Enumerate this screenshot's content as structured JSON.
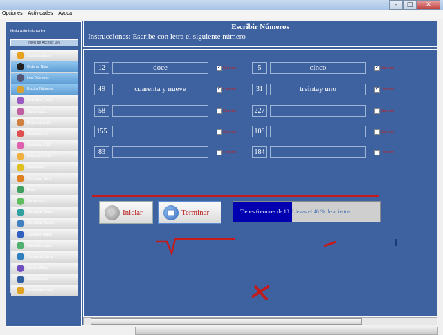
{
  "window": {
    "min": "–",
    "max": "□",
    "close": "✕"
  },
  "menu": [
    "Opciones",
    "Actividades",
    "Ayuda"
  ],
  "sidebar": {
    "greeting": "Hola Administrador",
    "level": "Nivel de Acceso: 0%",
    "items": [
      {
        "label": "Cuenta Líquido",
        "color": "#e8a020"
      },
      {
        "label": "Ordenar Núm.",
        "color": "#222222"
      },
      {
        "label": "Leer Números",
        "color": "#555577"
      },
      {
        "label": "Escribir Números",
        "color": "#d9a030"
      },
      {
        "label": "Ordinales 1 a 10",
        "color": "#9a5ac0"
      },
      {
        "label": "Suma hasta...",
        "color": "#c060a0"
      },
      {
        "label": "Resta hasta 10",
        "color": "#d08040"
      },
      {
        "label": "Multiplicar 1-5",
        "color": "#e05050"
      },
      {
        "label": "Multiplicar 1-10",
        "color": "#e060b0"
      },
      {
        "label": "Divisiones 1-10",
        "color": "#f0b040"
      },
      {
        "label": "Fracciones",
        "color": "#e0c020"
      },
      {
        "label": "Comparar Núm.",
        "color": "#e08020"
      },
      {
        "label": "Reloj",
        "color": "#40a060"
      },
      {
        "label": "Series num.",
        "color": "#60c060"
      },
      {
        "label": "Completar Series",
        "color": "#30a0a0"
      },
      {
        "label": "Completar Figura",
        "color": "#4080c0"
      },
      {
        "label": "Calcula el doble",
        "color": "#3060c0"
      },
      {
        "label": "Calcula la mitad",
        "color": "#50b070"
      },
      {
        "label": "Completar Suma",
        "color": "#3080c0"
      },
      {
        "label": "Suma y Resta",
        "color": "#7050c0"
      },
      {
        "label": "Multiplicación",
        "color": "#3060a0"
      },
      {
        "label": "Problemas Suma",
        "color": "#e0a020"
      }
    ]
  },
  "header": {
    "title": "Escribir Números",
    "instructions": "Instrucciones: Escribe con letra el siguiente número"
  },
  "rows": [
    {
      "left": {
        "num": "12",
        "ans": "doce",
        "checked": true
      },
      "right": {
        "num": "5",
        "ans": "cinco",
        "checked": true
      }
    },
    {
      "left": {
        "num": "49",
        "ans": "cuarenta y nueve",
        "checked": true
      },
      "right": {
        "num": "31",
        "ans": "treintay uno",
        "checked": true
      }
    },
    {
      "left": {
        "num": "58",
        "ans": "",
        "checked": false
      },
      "right": {
        "num": "227",
        "ans": "",
        "checked": false
      }
    },
    {
      "left": {
        "num": "155",
        "ans": "",
        "checked": false
      },
      "right": {
        "num": "108",
        "ans": "",
        "checked": false
      }
    },
    {
      "left": {
        "num": "83",
        "ans": "",
        "checked": false
      },
      "right": {
        "num": "184",
        "ans": "",
        "checked": false
      }
    }
  ],
  "check_label": "Correcto",
  "buttons": {
    "start": "Iniciar",
    "finish": "Terminar"
  },
  "status": {
    "errors_text": "Tienes 6 errores de 10.",
    "hits_text": "Llevas el 40 % de aciertos",
    "fill_fraction": 0.4
  },
  "colors": {
    "bg": "#3e62a0",
    "accent_red": "#c41a1a",
    "status_fill": "#0000b0"
  }
}
